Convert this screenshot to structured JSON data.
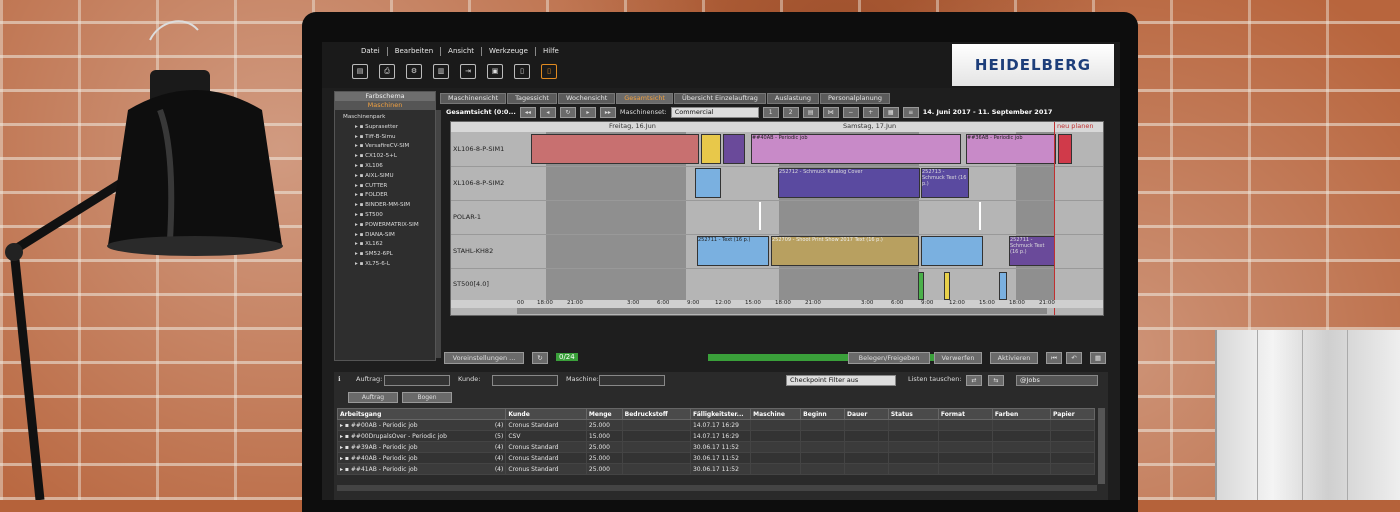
{
  "menu": [
    "Datei",
    "Bearbeiten",
    "Ansicht",
    "Werkzeuge",
    "Hilfe"
  ],
  "toolbar_icons": [
    "document-icon",
    "print-icon",
    "settings-icon",
    "factory-icon",
    "export-icon",
    "printer-icon",
    "page-icon",
    "highlight-page-icon"
  ],
  "logo": {
    "text": "HEIDELBERG",
    "brand_color": "#1d3e7a"
  },
  "left_panel": {
    "header1": "Farbschema",
    "header2": "Maschinen",
    "root": "Maschinenpark",
    "items": [
      "Suprasetter",
      "Tiff-B-Simu",
      "VersafireCV-SIM",
      "CX102-5+L",
      "XL106",
      "AIXL-SIMU",
      "CUTTER",
      "FOLDER",
      "BINDER-MM-SIM",
      "ST500",
      "POWERMATRIX-SIM",
      "DIANA-SIM",
      "XL162",
      "SM52-6PL",
      "XL75-6-L"
    ]
  },
  "tabs": [
    {
      "label": "Maschinensicht",
      "active": false
    },
    {
      "label": "Tagessicht",
      "active": false
    },
    {
      "label": "Wochensicht",
      "active": false
    },
    {
      "label": "Gesamtsicht",
      "active": true
    },
    {
      "label": "Übersicht Einzelauftrag",
      "active": false
    },
    {
      "label": "Auslastung",
      "active": false
    },
    {
      "label": "Personalplanung",
      "active": false
    }
  ],
  "gantt_toolbar": {
    "title": "Gesamtsicht (0:0...",
    "machine_set_label": "Maschinenset:",
    "machine_set_value": "Commercial",
    "btn1": "1",
    "btn2": "2",
    "date_range": "14. Juni 2017 - 11. September 2017"
  },
  "gantt": {
    "day1": "Freitag, 16.Jun",
    "day2": "Samstag, 17.Jun",
    "replan": "neu planen",
    "machines": [
      "XL106-8-P-SIM1",
      "XL106-8-P-SIM2",
      "POLAR-1",
      "STAHL-KH82",
      "ST500[4.0]"
    ],
    "bars": {
      "b1": "##40AB - Periodic job",
      "b2": "##36AB - Periodic job",
      "b3": "252712 - Schmuck Katalog Cover",
      "b4": "252713 - Schmuck Text (16 p.)",
      "b5": "252711 - Text (16 p.)",
      "b6": "252709 - Shoot Print Show 2017 Text (16 p.)",
      "b7": "252711 - Schmuck Text (16 p.)"
    },
    "axis": [
      "00",
      "18:00",
      "21:00",
      "3:00",
      "6:00",
      "9:00",
      "12:00",
      "15:00",
      "18:00",
      "21:00",
      "3:00",
      "6:00",
      "9:00",
      "12:00",
      "15:00",
      "18:00",
      "21:00"
    ]
  },
  "controls": {
    "presets": "Voreinstellungen ...",
    "counter": "0/24",
    "assign": "Belegen/Freigeben",
    "discard": "Verwerfen",
    "update": "Aktivieren"
  },
  "filters": {
    "order_label": "Auftrag:",
    "customer_label": "Kunde:",
    "machine_label": "Maschine:",
    "checkpoint": "Checkpoint Filter aus",
    "swap_lists": "Listen tauschen:",
    "jobs_value": "@Jobs",
    "group1": "Auftrag",
    "group2": "Bogen"
  },
  "table": {
    "columns": [
      "Arbeitsgang",
      "Kunde",
      "Menge",
      "Bedruckstoff",
      "Fälligkeitster...",
      "Maschine",
      "Beginn",
      "Dauer",
      "Status",
      "Format",
      "Farben",
      "Papier"
    ],
    "rows": [
      {
        "job": "##00AB - Periodic job",
        "n": "(4)",
        "customer": "Cronus Standard",
        "qty": "25.000",
        "due": "14.07.17 16:29"
      },
      {
        "job": "##00DrupalsOver - Periodic job",
        "n": "(5)",
        "customer": "CSV",
        "qty": "15.000",
        "due": "14.07.17 16:29"
      },
      {
        "job": "##39AB - Periodic job",
        "n": "(4)",
        "customer": "Cronus Standard",
        "qty": "25.000",
        "due": "30.06.17 11:52"
      },
      {
        "job": "##40AB - Periodic job",
        "n": "(4)",
        "customer": "Cronus Standard",
        "qty": "25.000",
        "due": "30.06.17 11:52"
      },
      {
        "job": "##41AB - Periodic job",
        "n": "(4)",
        "customer": "Cronus Standard",
        "qty": "25.000",
        "due": "30.06.17 11:52"
      }
    ]
  }
}
